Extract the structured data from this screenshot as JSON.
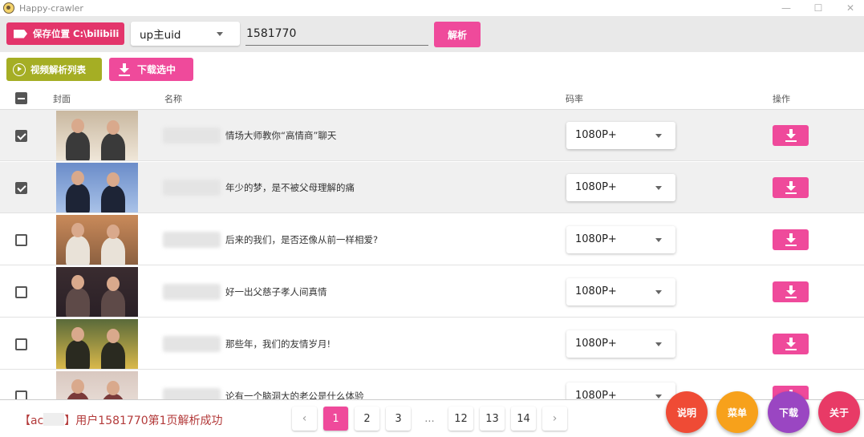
{
  "app": {
    "title": "Happy-crawler"
  },
  "window_controls": {
    "minimize": "—",
    "maximize": "☐",
    "close": "✕"
  },
  "toolbar": {
    "save_location_label": "保存位置 C:\\bilibili",
    "type_select_value": "up主uid",
    "uid_value": "1581770",
    "parse_label": "解析"
  },
  "actions": {
    "video_list_label": "视频解析列表",
    "download_selected_label": "下载选中"
  },
  "table": {
    "headers": {
      "cover": "封面",
      "name": "名称",
      "bitrate": "码率",
      "action": "操作"
    },
    "rows": [
      {
        "checked": true,
        "title": "情场大师教你“高情商”聊天",
        "quality": "1080P+"
      },
      {
        "checked": true,
        "title": "年少的梦，是不被父母理解的痛",
        "quality": "1080P+"
      },
      {
        "checked": false,
        "title": "后来的我们，是否还像从前一样相爱?",
        "quality": "1080P+"
      },
      {
        "checked": false,
        "title": "好一出父慈子孝人间真情",
        "quality": "1080P+"
      },
      {
        "checked": false,
        "title": "那些年，我们的友情岁月!",
        "quality": "1080P+"
      },
      {
        "checked": false,
        "title": "论有一个脑洞大的老公是什么体验",
        "quality": "1080P+"
      }
    ]
  },
  "status": {
    "prefix": "【ac",
    "suffix": "】用户1581770第1页解析成功"
  },
  "pagination": {
    "prev": "‹",
    "next": "›",
    "pages": [
      "1",
      "2",
      "3",
      "...",
      "12",
      "13",
      "14"
    ],
    "active": "1"
  },
  "fabs": {
    "help": "说明",
    "menu": "菜单",
    "download": "下载",
    "about": "关于"
  },
  "colors": {
    "accent_pink": "#ef4a9b",
    "save_red": "#e3356b",
    "olive": "#a5ae24",
    "fab_red": "#ef4b35",
    "fab_orange": "#f7a11b",
    "fab_purple": "#9a46c2",
    "fab_crimson": "#e83a66"
  }
}
